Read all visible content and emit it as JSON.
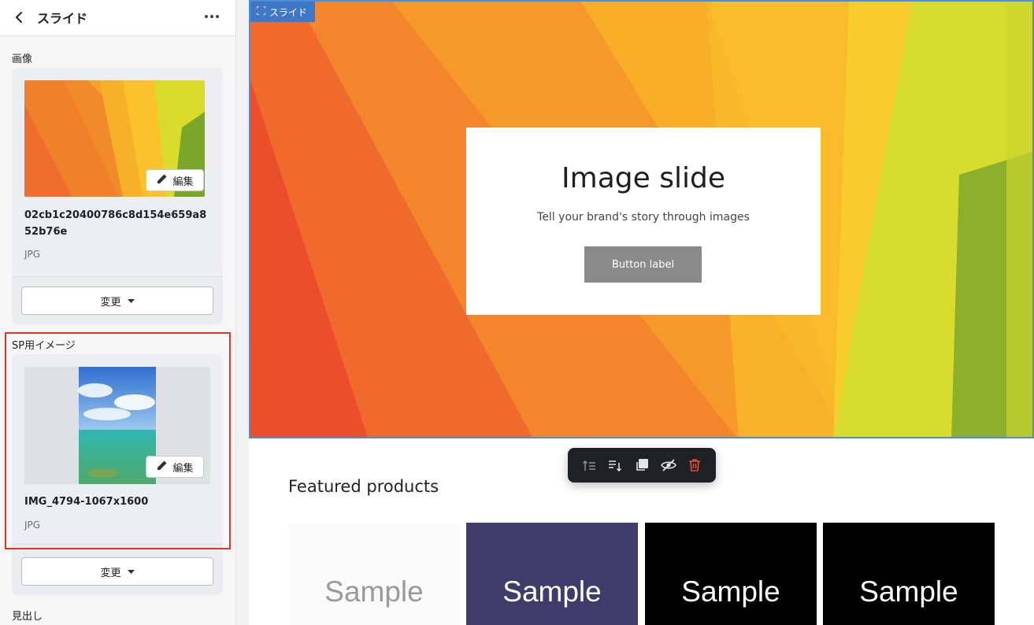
{
  "sidebar": {
    "title": "スライド",
    "image_label": "画像",
    "image": {
      "filename": "02cb1c20400786c8d154e659a852b76e",
      "type": "JPG",
      "edit_label": "編集",
      "change_label": "変更"
    },
    "sp_label": "SP用イメージ",
    "sp_image": {
      "filename": "IMG_4794-1067x1600",
      "type": "JPG",
      "edit_label": "編集",
      "change_label": "変更"
    },
    "heading_label": "見出し"
  },
  "preview": {
    "slide_tag": "スライド",
    "hero": {
      "title": "Image slide",
      "subtitle": "Tell your brand's story through images",
      "button": "Button label"
    },
    "featured_title": "Featured products",
    "products": [
      {
        "label": "Sample",
        "bg": "#fafafa",
        "color": "#9a9a9a"
      },
      {
        "label": "Sample",
        "bg": "#3e3c6b",
        "color": "#ffffff"
      },
      {
        "label": "Sample",
        "bg": "#000000",
        "color": "#ffffff"
      },
      {
        "label": "Sample",
        "bg": "#000000",
        "color": "#ffffff"
      }
    ],
    "toolbar_icons": [
      "move-up-icon",
      "move-down-icon",
      "duplicate-icon",
      "hide-icon",
      "delete-icon"
    ]
  },
  "colors": {
    "highlight": "#e0351f",
    "selection": "#4a90d9",
    "delete": "#e8503a"
  }
}
